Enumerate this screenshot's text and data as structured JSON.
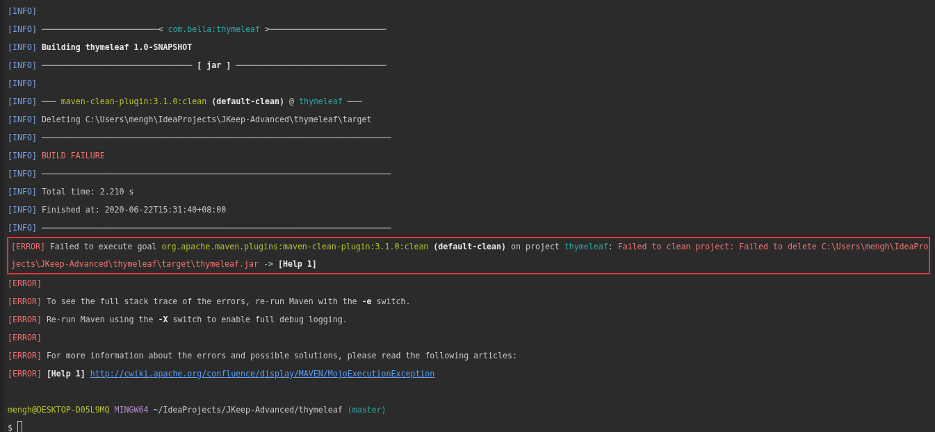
{
  "terminal": {
    "lines": [
      {
        "kind": "line",
        "segments": [
          {
            "kind": "info",
            "text": "[INFO]"
          }
        ]
      },
      {
        "kind": "line",
        "segments": [
          {
            "kind": "info",
            "text": "[INFO]"
          },
          {
            "kind": "rule",
            "text": "────────────────────────<"
          },
          {
            "kind": "cyan",
            "text": "com.bella:thymeleaf"
          },
          {
            "kind": "rule",
            "text": ">────────────────────────"
          }
        ]
      },
      {
        "kind": "line",
        "segments": [
          {
            "kind": "info",
            "text": "[INFO]"
          },
          {
            "kind": "bold",
            "text": "Building thymeleaf 1.0-SNAPSHOT"
          }
        ]
      },
      {
        "kind": "line",
        "segments": [
          {
            "kind": "info",
            "text": "[INFO]"
          },
          {
            "kind": "rule",
            "text": "───────────────────────────────"
          },
          {
            "kind": "bold",
            "text": "[ jar ]"
          },
          {
            "kind": "rule",
            "text": "───────────────────────────────"
          }
        ]
      },
      {
        "kind": "line",
        "segments": [
          {
            "kind": "info",
            "text": "[INFO]"
          }
        ]
      },
      {
        "kind": "line",
        "segments": [
          {
            "kind": "info",
            "text": "[INFO]"
          },
          {
            "kind": "rule",
            "text": "───"
          },
          {
            "kind": "yellow",
            "text": "maven-clean-plugin:3.1.0:clean"
          },
          {
            "kind": "bold",
            "text": "(default-clean)"
          },
          {
            "kind": "plain",
            "text": "@"
          },
          {
            "kind": "cyan",
            "text": "thymeleaf"
          },
          {
            "kind": "rule",
            "text": "───"
          }
        ]
      },
      {
        "kind": "line",
        "segments": [
          {
            "kind": "info",
            "text": "[INFO]"
          },
          {
            "kind": "plain",
            "text": "Deleting C:\\Users\\mengh\\IdeaProjects\\JKeep-Advanced\\thymeleaf\\target"
          }
        ]
      },
      {
        "kind": "line",
        "segments": [
          {
            "kind": "info",
            "text": "[INFO]"
          },
          {
            "kind": "rule",
            "text": "────────────────────────────────────────────────────────────────────────"
          }
        ]
      },
      {
        "kind": "line",
        "segments": [
          {
            "kind": "info",
            "text": "[INFO]"
          },
          {
            "kind": "red",
            "text": "BUILD FAILURE"
          }
        ]
      },
      {
        "kind": "line",
        "segments": [
          {
            "kind": "info",
            "text": "[INFO]"
          },
          {
            "kind": "rule",
            "text": "────────────────────────────────────────────────────────────────────────"
          }
        ]
      },
      {
        "kind": "line",
        "segments": [
          {
            "kind": "info",
            "text": "[INFO]"
          },
          {
            "kind": "plain",
            "text": "Total time: 2.210 s"
          }
        ]
      },
      {
        "kind": "line",
        "segments": [
          {
            "kind": "info",
            "text": "[INFO]"
          },
          {
            "kind": "plain",
            "text": "Finished at: 2020-06-22T15:31:40+08:00"
          }
        ]
      },
      {
        "kind": "line",
        "segments": [
          {
            "kind": "info",
            "text": "[INFO]"
          },
          {
            "kind": "rule",
            "text": "────────────────────────────────────────────────────────────────────────"
          }
        ]
      },
      {
        "kind": "highlight",
        "lines": [
          {
            "segments": [
              {
                "kind": "error",
                "text": "[ERROR]"
              },
              {
                "kind": "plain",
                "text": "Failed to execute goal"
              },
              {
                "kind": "yellow",
                "text": "org.apache.maven.plugins:maven-clean-plugin:3.1.0:clean"
              },
              {
                "kind": "bold",
                "text": "(default-clean)"
              },
              {
                "kind": "plain",
                "text": "on project"
              },
              {
                "kind": "cyan",
                "text": "thymeleaf"
              },
              {
                "kind": "punct",
                "text": ":"
              },
              {
                "kind": "red",
                "text": "Failed to clean project: Failed to delete C:\\Users\\mengh\\IdeaPro"
              }
            ]
          },
          {
            "segments": [
              {
                "kind": "red",
                "text": "jects\\JKeep-Advanced\\thymeleaf\\target\\thymeleaf.jar"
              },
              {
                "kind": "plain",
                "text": "->"
              },
              {
                "kind": "bold",
                "text": "[Help 1]"
              }
            ]
          }
        ]
      },
      {
        "kind": "line",
        "segments": [
          {
            "kind": "error",
            "text": "[ERROR]"
          }
        ]
      },
      {
        "kind": "line",
        "segments": [
          {
            "kind": "error",
            "text": "[ERROR]"
          },
          {
            "kind": "plain",
            "text": "To see the full stack trace of the errors, re-run Maven with the"
          },
          {
            "kind": "bold",
            "text": "-e"
          },
          {
            "kind": "plain",
            "text": "switch."
          }
        ]
      },
      {
        "kind": "line",
        "segments": [
          {
            "kind": "error",
            "text": "[ERROR]"
          },
          {
            "kind": "plain",
            "text": "Re-run Maven using the"
          },
          {
            "kind": "bold",
            "text": "-X"
          },
          {
            "kind": "plain",
            "text": "switch to enable full debug logging."
          }
        ]
      },
      {
        "kind": "line",
        "segments": [
          {
            "kind": "error",
            "text": "[ERROR]"
          }
        ]
      },
      {
        "kind": "line",
        "segments": [
          {
            "kind": "error",
            "text": "[ERROR]"
          },
          {
            "kind": "plain",
            "text": "For more information about the errors and possible solutions, please read the following articles:"
          }
        ]
      },
      {
        "kind": "line",
        "segments": [
          {
            "kind": "error",
            "text": "[ERROR]"
          },
          {
            "kind": "bold",
            "text": "[Help 1]"
          },
          {
            "kind": "link",
            "text": "http://cwiki.apache.org/confluence/display/MAVEN/MojoExecutionException"
          }
        ]
      },
      {
        "kind": "blank"
      },
      {
        "kind": "line",
        "segments": [
          {
            "kind": "yellow",
            "text": "mengh@DESKTOP-D05L9MQ"
          },
          {
            "kind": "purple",
            "text": "MINGW64"
          },
          {
            "kind": "plain",
            "text": "~/IdeaProjects/JKeep-Advanced/thymeleaf"
          },
          {
            "kind": "cyan",
            "text": "(master)"
          }
        ]
      },
      {
        "kind": "prompt",
        "segments": [
          {
            "kind": "plain",
            "text": "$"
          }
        ]
      }
    ]
  }
}
